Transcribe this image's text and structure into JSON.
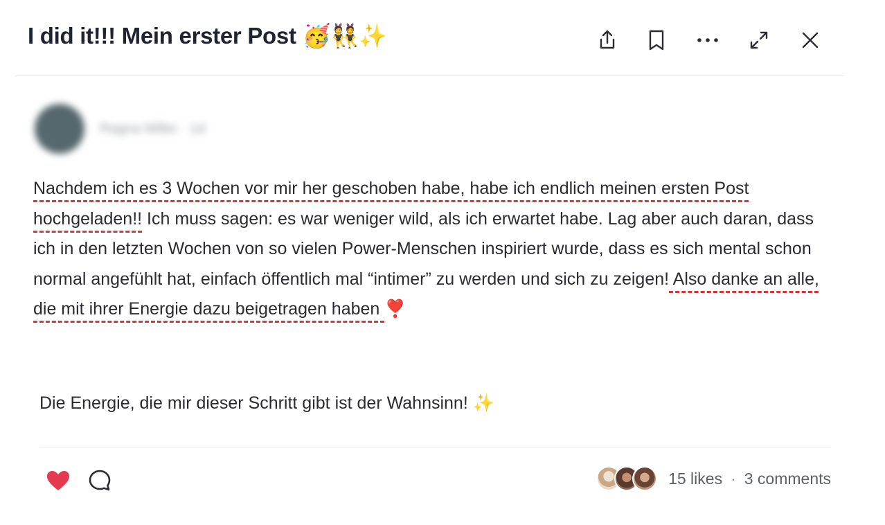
{
  "post": {
    "title": "I did it!!! Mein erster Post 🥳👯✨",
    "author_name": "Ragna Miller · 1d",
    "body": {
      "seg1": "Nachdem ich es 3 Wochen vor mir her geschoben habe, habe ich endlich meinen ersten Post hochgeladen!!",
      "seg2": " Ich muss sagen: es war weniger wild, als ich erwartet habe. Lag aber auch daran, dass ich in den letzten Wochen von so vielen Power-Menschen inspiriert wurde, dass es sich mental schon normal angefühlt hat, einfach öffentlich mal “intimer” zu werden und sich zu zeigen!",
      "seg3": " Also danke an alle, die mit ihrer Energie dazu beigetragen haben ",
      "seg4": "❣️"
    },
    "closing": "Die Energie, die mir dieser Schritt gibt ist der Wahnsinn! ✨"
  },
  "header_actions": {
    "share": "share-icon",
    "bookmark": "bookmark-icon",
    "more": "more-icon",
    "expand": "expand-icon",
    "close": "close-icon"
  },
  "footer": {
    "likes": "15 likes",
    "separator": "·",
    "comments": "3 comments"
  },
  "colors": {
    "heart": "#e53950",
    "spellcheck": "#d23a3a",
    "title": "#1f2430"
  }
}
